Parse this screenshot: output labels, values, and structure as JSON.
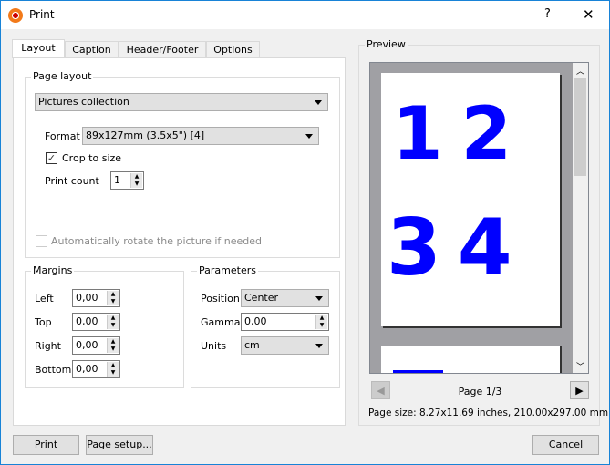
{
  "window": {
    "title": "Print",
    "help": "?",
    "close": "✕"
  },
  "tabs": [
    "Layout",
    "Caption",
    "Header/Footer",
    "Options"
  ],
  "page_layout": {
    "label": "Page layout",
    "mode": "Pictures collection",
    "format_label": "Format",
    "format": "89x127mm (3.5x5\") [4]",
    "crop_label": "Crop to size",
    "crop_checked": true,
    "count_label": "Print count",
    "count": "1",
    "autorotate_label": "Automatically rotate the picture if needed",
    "autorotate_checked": false
  },
  "margins": {
    "label": "Margins",
    "left_label": "Left",
    "left": "0,00",
    "top_label": "Top",
    "top": "0,00",
    "right_label": "Right",
    "right": "0,00",
    "bottom_label": "Bottom",
    "bottom": "0,00"
  },
  "parameters": {
    "label": "Parameters",
    "position_label": "Position",
    "position": "Center",
    "gamma_label": "Gamma",
    "gamma": "0,00",
    "units_label": "Units",
    "units": "cm"
  },
  "preview": {
    "label": "Preview",
    "page1_text_row1": "1 2",
    "page1_text_row2": "3 4",
    "page_indicator": "Page 1/3",
    "page_size": "Page size: 8.27x11.69 inches, 210.00x297.00 mm"
  },
  "buttons": {
    "print": "Print",
    "page_setup": "Page setup...",
    "cancel": "Cancel"
  },
  "colors": {
    "preview_text": "#0000ff",
    "accent": "#1883d7"
  }
}
